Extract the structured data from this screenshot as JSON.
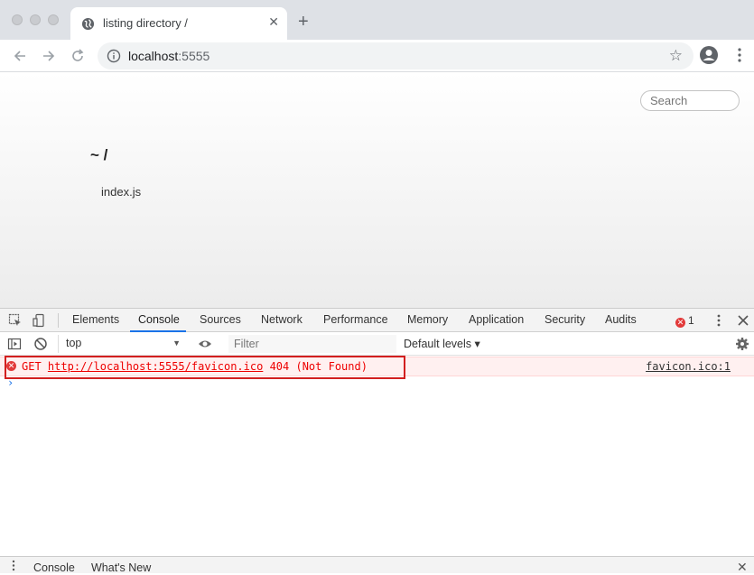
{
  "browser": {
    "tab": {
      "title": "listing directory /",
      "close_glyph": "✕"
    },
    "new_tab_glyph": "+",
    "omnibox": {
      "host": "localhost",
      "port": ":5555"
    }
  },
  "page": {
    "search_placeholder": "Search",
    "heading": "~ /",
    "files": [
      "index.js"
    ]
  },
  "devtools": {
    "tabs": [
      "Elements",
      "Console",
      "Sources",
      "Network",
      "Performance",
      "Memory",
      "Application",
      "Security",
      "Audits"
    ],
    "active_tab": "Console",
    "error_count": "1",
    "context": "top",
    "filter_placeholder": "Filter",
    "levels": "Default levels ▾",
    "console": {
      "error": {
        "method": "GET",
        "url": "http://localhost:5555/favicon.ico",
        "status": "404 (Not Found)",
        "source": "favicon.ico:1"
      },
      "prompt": "›"
    },
    "drawer_tabs": [
      "Console",
      "What's New"
    ]
  },
  "colors": {
    "error": "#e00000",
    "highlight": "#d21f1f",
    "accent": "#1a73e8"
  }
}
